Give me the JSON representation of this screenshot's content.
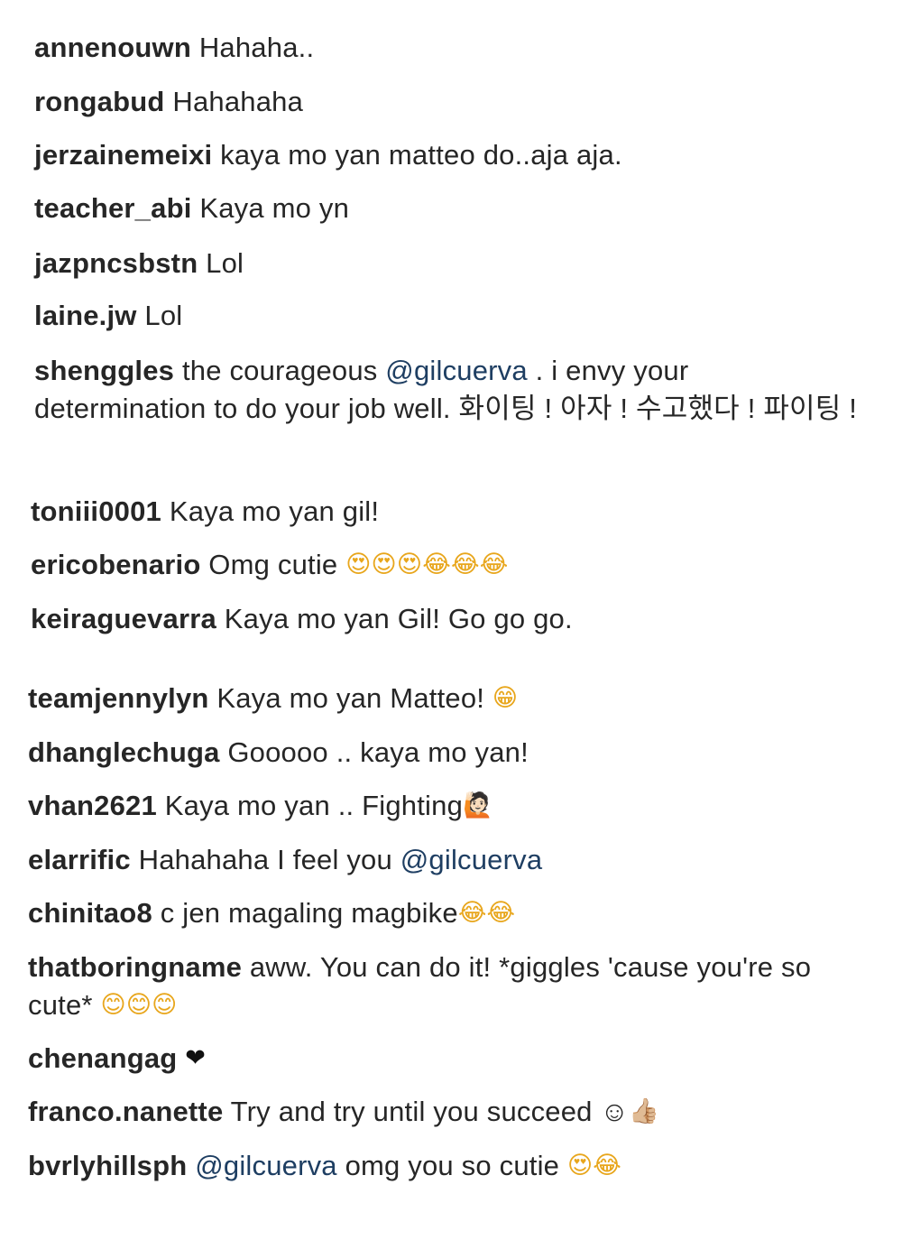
{
  "comments": [
    {
      "user": "annenouwn",
      "parts": [
        {
          "text": "Hahaha.."
        }
      ]
    },
    {
      "user": "rongabud",
      "parts": [
        {
          "text": "Hahahaha"
        }
      ]
    },
    {
      "user": "jerzainemeixi",
      "parts": [
        {
          "text": "kaya mo yan matteo do..aja aja."
        }
      ]
    },
    {
      "user": "teacher_abi",
      "parts": [
        {
          "text": "Kaya mo yn"
        }
      ]
    },
    {
      "user": "jazpncsbstn",
      "parts": [
        {
          "text": "Lol"
        }
      ]
    },
    {
      "user": "laine.jw",
      "parts": [
        {
          "text": "Lol"
        }
      ]
    },
    {
      "user": "shenggles",
      "parts": [
        {
          "text": "the courageous "
        },
        {
          "mention": "@gilcuerva"
        },
        {
          "text": " . i envy your determination to do your job well. 화이팅 ! 아자 ! 수고했다 ! 파이팅 !"
        }
      ]
    },
    {
      "user": "toniii0001",
      "parts": [
        {
          "text": "Kaya mo yan gil!"
        }
      ]
    },
    {
      "user": "ericobenario",
      "parts": [
        {
          "text": "Omg cutie "
        },
        {
          "emoji": "😍😍😍😂😂😂",
          "icon": "heart-eyes-and-tears-of-joy-emoji"
        }
      ]
    },
    {
      "user": "keiraguevarra",
      "parts": [
        {
          "text": "Kaya mo yan Gil! Go go go."
        }
      ]
    },
    {
      "user": "teamjennylyn",
      "parts": [
        {
          "text": "Kaya mo yan Matteo! "
        },
        {
          "emoji": "😁",
          "icon": "grinning-emoji"
        }
      ]
    },
    {
      "user": "dhanglechuga",
      "parts": [
        {
          "text": "Gooooo .. kaya mo yan!"
        }
      ]
    },
    {
      "user": "vhan2621",
      "parts": [
        {
          "text": "Kaya mo yan .. Fighting"
        },
        {
          "emoji": "🙋🏻",
          "icon": "raising-hand-emoji"
        }
      ]
    },
    {
      "user": "elarrific",
      "parts": [
        {
          "text": "Hahahaha I feel you "
        },
        {
          "mention": "@gilcuerva"
        }
      ]
    },
    {
      "user": "chinitao8",
      "parts": [
        {
          "text": "c jen magaling magbike"
        },
        {
          "emoji": "😂😂",
          "icon": "tears-of-joy-emoji"
        }
      ]
    },
    {
      "user": "thatboringname",
      "parts": [
        {
          "text": "aww. You can do it! *giggles 'cause you're so cute* "
        },
        {
          "emoji": "😊😊😊",
          "icon": "smiling-emoji"
        }
      ]
    },
    {
      "user": "chenangag",
      "parts": [
        {
          "emoji": "❤",
          "icon": "heart-emoji"
        }
      ]
    },
    {
      "user": "franco.nanette",
      "parts": [
        {
          "text": "Try and try until you succeed ☺"
        },
        {
          "emoji": "👍🏼",
          "icon": "thumbs-up-emoji"
        }
      ]
    },
    {
      "user": "bvrlyhillsph",
      "parts": [
        {
          "mention": "@gilcuerva"
        },
        {
          "text": " omg you so cutie "
        },
        {
          "emoji": "😍😂",
          "icon": "heart-eyes-and-tears-of-joy-emoji"
        }
      ]
    }
  ],
  "colors": {
    "text": "#262626",
    "mention": "#1e3e62",
    "background": "#ffffff"
  }
}
